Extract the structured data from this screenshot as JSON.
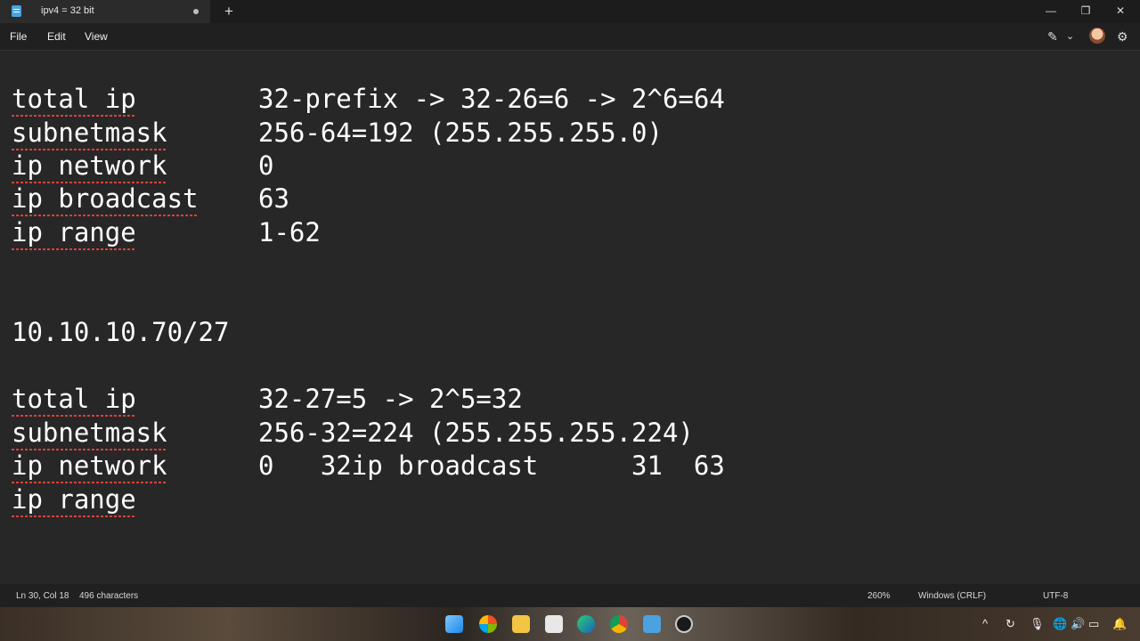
{
  "window": {
    "tab_title": "ipv4 = 32 bit",
    "new_tab": "+",
    "minimize": "—",
    "maximize": "❐",
    "close": "✕"
  },
  "menu": {
    "file": "File",
    "edit": "Edit",
    "view": "View",
    "copilot_icon": "✎",
    "dropdown_icon": "⌄",
    "settings_icon": "⚙"
  },
  "document": {
    "lines": [
      {
        "label": "total ip",
        "value": "32-prefix -> 32-26=6 -> 2^6=64"
      },
      {
        "label": "subnetmask",
        "value": "256-64=192 (255.255.255.0)"
      },
      {
        "label": "ip network",
        "value": "0"
      },
      {
        "label": "ip broadcast",
        "value": "63"
      },
      {
        "label": "ip range",
        "value": "1-62"
      },
      {
        "label": "10.10.10.70/27",
        "value": ""
      },
      {
        "label": "total ip",
        "value": "32-27=5 -> 2^5=32"
      },
      {
        "label": "subnetmask",
        "value": "256-32=224 (255.255.255.224)"
      },
      {
        "label": "ip network",
        "value": "0   32ip broadcast      31  63"
      },
      {
        "label": "ip range",
        "value": ""
      }
    ]
  },
  "status": {
    "position": "Ln 30, Col 18",
    "characters": "496 characters",
    "zoom": "260%",
    "line_ending": "Windows (CRLF)",
    "encoding": "UTF-8"
  },
  "taskbar": {
    "tray_chevron": "^",
    "tray_sync": "↻",
    "tray_mic": "🎙",
    "tray_globe": "🌐",
    "tray_volume": "🔊",
    "tray_battery": "▭",
    "tray_bell": "🔔"
  }
}
